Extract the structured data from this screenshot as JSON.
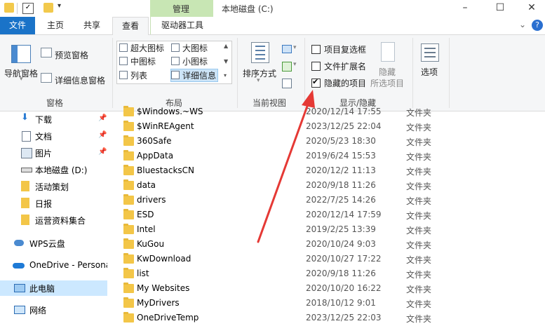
{
  "titlebar": {
    "context_group": "管理",
    "window_title": "本地磁盘 (C:)",
    "minimize_glyph": "–",
    "maximize_glyph": "☐",
    "close_glyph": "✕"
  },
  "tabs": [
    {
      "label": "文件"
    },
    {
      "label": "主页"
    },
    {
      "label": "共享"
    },
    {
      "label": "查看"
    },
    {
      "label": "驱动器工具"
    }
  ],
  "ribbon": {
    "panes": {
      "nav_pane_label": "导航窗格",
      "preview_pane_label": "预览窗格",
      "details_pane_label": "详细信息窗格",
      "group_label": "窗格"
    },
    "layout": {
      "items": [
        "超大图标",
        "大图标",
        "中图标",
        "小图标",
        "列表",
        "详细信息"
      ],
      "group_label": "布局"
    },
    "current_view": {
      "sort_label": "排序方式",
      "group_label": "当前视图"
    },
    "show_hide": {
      "item_checkboxes": "项目复选框",
      "file_extensions": "文件扩展名",
      "hidden_items": "隐藏的项目",
      "hide_button_line1": "隐藏",
      "hide_button_line2": "所选项目",
      "group_label": "显示/隐藏"
    },
    "options_label": "选项",
    "help_glyph": "?"
  },
  "nav": {
    "items": [
      {
        "label": "下载",
        "pinned": true
      },
      {
        "label": "文档",
        "pinned": true
      },
      {
        "label": "图片",
        "pinned": true
      },
      {
        "label": "本地磁盘 (D:)"
      },
      {
        "label": "活动策划"
      },
      {
        "label": "日报"
      },
      {
        "label": "运营资料集合"
      },
      {
        "label": "WPS云盘"
      },
      {
        "label": "OneDrive - Persona"
      },
      {
        "label": "此电脑"
      },
      {
        "label": "网络"
      }
    ]
  },
  "files": [
    {
      "name": "$Windows.~WS",
      "date": "2020/12/14 17:55",
      "type": "文件夹"
    },
    {
      "name": "$WinREAgent",
      "date": "2023/12/25 22:04",
      "type": "文件夹"
    },
    {
      "name": "360Safe",
      "date": "2020/5/23 18:30",
      "type": "文件夹"
    },
    {
      "name": "AppData",
      "date": "2019/6/24 15:53",
      "type": "文件夹"
    },
    {
      "name": "BluestacksCN",
      "date": "2020/12/2 11:13",
      "type": "文件夹"
    },
    {
      "name": "data",
      "date": "2020/9/18 11:26",
      "type": "文件夹"
    },
    {
      "name": "drivers",
      "date": "2022/7/25 14:26",
      "type": "文件夹"
    },
    {
      "name": "ESD",
      "date": "2020/12/14 17:59",
      "type": "文件夹"
    },
    {
      "name": "Intel",
      "date": "2019/2/25 13:39",
      "type": "文件夹"
    },
    {
      "name": "KuGou",
      "date": "2020/10/24 9:03",
      "type": "文件夹"
    },
    {
      "name": "KwDownload",
      "date": "2020/10/27 17:22",
      "type": "文件夹"
    },
    {
      "name": "list",
      "date": "2020/9/18 11:26",
      "type": "文件夹"
    },
    {
      "name": "My Websites",
      "date": "2020/10/20 16:22",
      "type": "文件夹"
    },
    {
      "name": "MyDrivers",
      "date": "2018/10/12 9:01",
      "type": "文件夹"
    },
    {
      "name": "OneDriveTemp",
      "date": "2023/12/25 22:03",
      "type": "文件夹"
    }
  ],
  "colors": {
    "accent": "#1a73c8",
    "context_tab": "#c8e6b4",
    "selection": "#cce8ff",
    "annotation_arrow": "#e53935"
  }
}
